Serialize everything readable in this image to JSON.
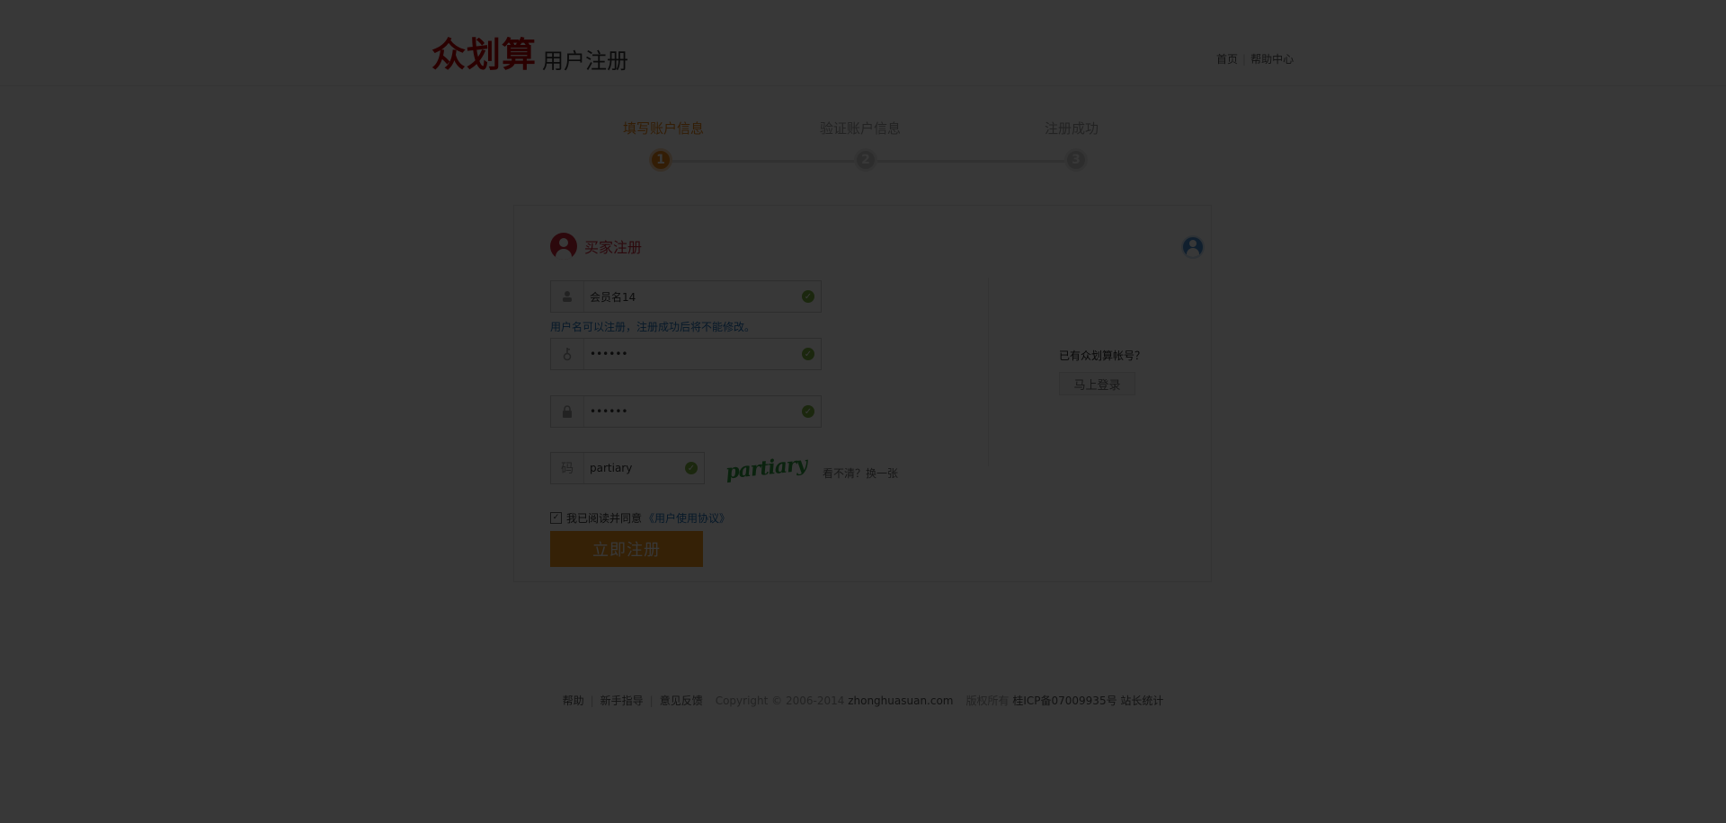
{
  "header": {
    "logo": "众划算",
    "subtitle": "用户注册",
    "links": [
      "首页",
      "帮助中心"
    ]
  },
  "steps": [
    {
      "label": "填写账户信息",
      "num": "1",
      "active": true
    },
    {
      "label": "验证账户信息",
      "num": "2",
      "active": false
    },
    {
      "label": "注册成功",
      "num": "3",
      "active": false
    }
  ],
  "form": {
    "title": "买家注册",
    "username": {
      "value": "会员名14",
      "valid": true
    },
    "hint": "用户名可以注册，注册成功后将不能修改。",
    "password": {
      "value": "••••••",
      "valid": true
    },
    "confirm_password": {
      "value": "••••••",
      "valid": true
    },
    "captcha": {
      "icon_text": "码",
      "value": "partiary",
      "image_text": "partiary",
      "refresh_text": "看不清？换一张"
    },
    "agree": {
      "checked": true,
      "text": "我已阅读并同意",
      "link": "《用户使用协议》"
    },
    "submit": "立即注册"
  },
  "side": {
    "question": "已有众划算帐号？",
    "login": "马上登录"
  },
  "footer": {
    "links": [
      "帮助",
      "新手指导",
      "意见反馈"
    ],
    "copyright": "Copyright © 2006-2014",
    "domain": "zhonghuasuan.com",
    "rights": "版权所有",
    "icp": "桂ICP备07009935号",
    "stats": "站长统计"
  },
  "colors": {
    "brand_red": "#c00000",
    "accent_orange": "#e8861a",
    "link_blue": "#1f6fb8",
    "valid_green": "#7cb342",
    "overlay": "rgba(0,0,0,0.78)"
  }
}
